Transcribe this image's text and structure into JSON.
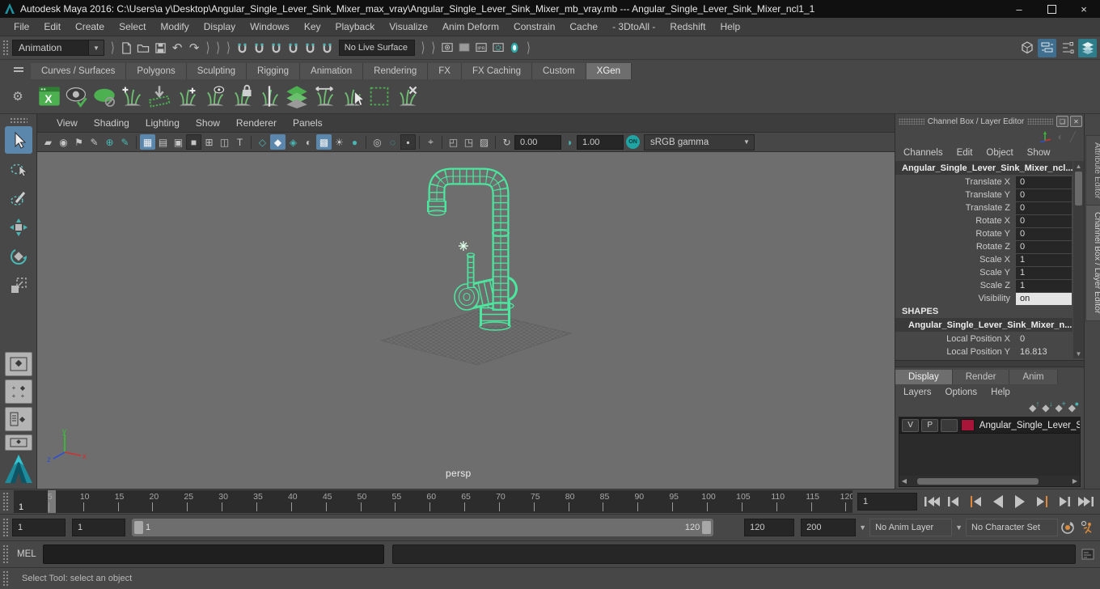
{
  "title_bar": {
    "title": "Autodesk Maya 2016: C:\\Users\\a y\\Desktop\\Angular_Single_Lever_Sink_Mixer_max_vray\\Angular_Single_Lever_Sink_Mixer_mb_vray.mb  ---  Angular_Single_Lever_Sink_Mixer_ncl1_1"
  },
  "menu_bar": {
    "items": [
      "File",
      "Edit",
      "Create",
      "Select",
      "Modify",
      "Display",
      "Windows",
      "Key",
      "Playback",
      "Visualize",
      "Anim Deform",
      "Constrain",
      "Cache",
      "- 3DtoAll -",
      "Redshift",
      "Help"
    ]
  },
  "status_line": {
    "menu_set": "Animation",
    "live_surface": "No Live Surface",
    "ipr_label": "IPR",
    "icons": [
      "new-scene",
      "open-scene",
      "save-scene",
      "undo",
      "redo",
      "snap-to-grids",
      "snap-to-curves",
      "snap-to-points",
      "snap-to-projected-center",
      "snap-to-view-planes",
      "make-live",
      "render-view",
      "render-current-frame",
      "ipr-render",
      "render-settings",
      "paint-effects",
      "modeling-toolkit",
      "tool-settings",
      "attribute-editor-toggle",
      "channel-box-toggle"
    ]
  },
  "shelf": {
    "tabs": [
      "Curves / Surfaces",
      "Polygons",
      "Sculpting",
      "Rigging",
      "Animation",
      "Rendering",
      "FX",
      "FX Caching",
      "Custom",
      "XGen"
    ],
    "active_tab": "XGen",
    "xgen_window_label": "X",
    "icons": [
      {
        "name": "xgen-editor-icon",
        "kind": "window-x"
      },
      {
        "name": "xgen-preview-refresh-icon",
        "kind": "eye-check"
      },
      {
        "name": "xgen-preview-off-icon",
        "kind": "oval-off"
      },
      {
        "name": "xgen-add-description-icon",
        "kind": "grass-plus2"
      },
      {
        "name": "xgen-export-patches-icon",
        "kind": "export-ribbon"
      },
      {
        "name": "xgen-create-description-icon",
        "kind": "grass-plus"
      },
      {
        "name": "xgen-description-visibility-icon",
        "kind": "grass-eye"
      },
      {
        "name": "xgen-lock-description-icon",
        "kind": "grass-lock"
      },
      {
        "name": "xgen-split-description-icon",
        "kind": "grass-split"
      },
      {
        "name": "xgen-layer-stack-icon",
        "kind": "layers"
      },
      {
        "name": "xgen-width-tool-icon",
        "kind": "grass-width"
      },
      {
        "name": "xgen-select-description-icon",
        "kind": "grass-select"
      },
      {
        "name": "xgen-region-tool-icon",
        "kind": "region"
      },
      {
        "name": "xgen-delete-description-icon",
        "kind": "grass-delete"
      }
    ]
  },
  "viewport": {
    "menus": [
      "View",
      "Shading",
      "Lighting",
      "Show",
      "Renderer",
      "Panels"
    ],
    "icons": [
      {
        "name": "select-camera-icon",
        "glyph": "▰"
      },
      {
        "name": "lock-camera-icon",
        "glyph": "◉"
      },
      {
        "name": "bookmark-icon",
        "glyph": "⚑"
      },
      {
        "name": "grease-pencil-icon",
        "glyph": "✎"
      },
      {
        "name": "camera-attributes-icon",
        "glyph": "⊕",
        "teal": true
      },
      {
        "name": "pencil-icon",
        "glyph": "✎",
        "teal": true
      },
      {
        "sep": true
      },
      {
        "name": "grid-icon",
        "glyph": "▦",
        "active": true
      },
      {
        "name": "film-gate-icon",
        "glyph": "▤"
      },
      {
        "name": "resolution-gate-icon",
        "glyph": "▣"
      },
      {
        "name": "gate-mask-icon",
        "glyph": "■",
        "dark": true
      },
      {
        "name": "field-chart-icon",
        "glyph": "⊞"
      },
      {
        "name": "safe-action-icon",
        "glyph": "◫"
      },
      {
        "name": "safe-title-icon",
        "glyph": "T"
      },
      {
        "sep": true
      },
      {
        "name": "wireframe-icon",
        "glyph": "◇",
        "teal": true
      },
      {
        "name": "shaded-icon",
        "glyph": "◆",
        "active": true
      },
      {
        "name": "textured-icon",
        "glyph": "◈",
        "teal": true
      },
      {
        "name": "use-default-material-icon",
        "glyph": "◐"
      },
      {
        "name": "textured-checker-icon",
        "glyph": "▩",
        "active": true
      },
      {
        "name": "lights-icon",
        "glyph": "☀"
      },
      {
        "name": "shadows-icon",
        "glyph": "●",
        "teal": true
      },
      {
        "sep": true
      },
      {
        "name": "occlusion-icon",
        "glyph": "◎"
      },
      {
        "name": "motion-blur-icon",
        "glyph": "◌",
        "teal": true
      },
      {
        "name": "translucency-icon",
        "glyph": "▪",
        "dark": true
      },
      {
        "sep": true
      },
      {
        "name": "object-select-icon",
        "glyph": "⌖"
      },
      {
        "sep": true
      },
      {
        "name": "isolate-select-icon",
        "glyph": "◰"
      },
      {
        "name": "isolate-add-icon",
        "glyph": "◳"
      },
      {
        "name": "image-plane-icon",
        "glyph": "▨"
      },
      {
        "sep": true
      },
      {
        "name": "exposure-refresh-icon",
        "glyph": "↻"
      }
    ],
    "toolbar": {
      "exposure": "0.00",
      "gamma": "1.00",
      "on_label": "ON",
      "view_transform": "sRGB gamma"
    },
    "camera_label": "persp",
    "axis_labels": {
      "x": "x",
      "y": "y",
      "z": "z"
    },
    "model_color": "#4be79f"
  },
  "channel_box": {
    "title": "Channel Box / Layer Editor",
    "menus": [
      "Channels",
      "Edit",
      "Object",
      "Show"
    ],
    "object_name": "Angular_Single_Lever_Sink_Mixer_ncl...",
    "attributes": [
      {
        "label": "Translate X",
        "value": "0"
      },
      {
        "label": "Translate Y",
        "value": "0"
      },
      {
        "label": "Translate Z",
        "value": "0"
      },
      {
        "label": "Rotate X",
        "value": "0"
      },
      {
        "label": "Rotate Y",
        "value": "0"
      },
      {
        "label": "Rotate Z",
        "value": "0"
      },
      {
        "label": "Scale X",
        "value": "1"
      },
      {
        "label": "Scale Y",
        "value": "1"
      },
      {
        "label": "Scale Z",
        "value": "1"
      },
      {
        "label": "Visibility",
        "value": "on",
        "light": true
      }
    ],
    "shapes_header": "SHAPES",
    "shape_name": "Angular_Single_Lever_Sink_Mixer_n...",
    "shape_attributes": [
      {
        "label": "Local Position X",
        "value": "0"
      },
      {
        "label": "Local Position Y",
        "value": "16.813"
      }
    ]
  },
  "sidebar": {
    "tabs": [
      "Attribute Editor",
      "Channel Box / Layer Editor"
    ],
    "active": "Channel Box / Layer Editor"
  },
  "layer_editor": {
    "tabs": [
      "Display",
      "Render",
      "Anim"
    ],
    "active_tab": "Display",
    "menus": [
      "Layers",
      "Options",
      "Help"
    ],
    "layer": {
      "visibility_label": "V",
      "playback_label": "P",
      "name": "Angular_Single_Lever_Si",
      "color": "#a91538"
    }
  },
  "time_slider": {
    "ticks": [
      "5",
      "10",
      "15",
      "20",
      "25",
      "30",
      "35",
      "40",
      "45",
      "50",
      "55",
      "60",
      "65",
      "70",
      "75",
      "80",
      "85",
      "90",
      "95",
      "100",
      "105",
      "110",
      "115",
      "120"
    ],
    "range_max": 121,
    "current_frame": "1",
    "current_time": "1",
    "transport": [
      "go-to-start",
      "step-back-key",
      "step-back-frame",
      "play-backwards",
      "play-forwards",
      "step-forward-frame",
      "step-forward-key",
      "go-to-end"
    ]
  },
  "range_slider": {
    "anim_start": "1",
    "playback_start": "1",
    "bar_start_label": "1",
    "bar_end_label": "120",
    "playback_end": "120",
    "anim_end": "200",
    "anim_layer": "No Anim Layer",
    "character_set": "No Character Set"
  },
  "command_line": {
    "label": "MEL"
  },
  "help_line": {
    "text": "Select Tool: select an object"
  }
}
